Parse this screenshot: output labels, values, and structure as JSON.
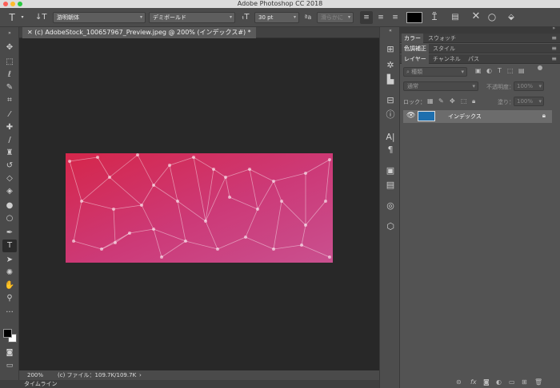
{
  "window": {
    "title": "Adobe Photoshop CC 2018"
  },
  "options": {
    "font_family": "游明朝体",
    "font_style": "デミボールド",
    "font_size": "30 pt",
    "aa_label": "ªa",
    "antialias": "滑らかに",
    "text_color": "#000000"
  },
  "document": {
    "tab_title": "(c) AdobeStock_100657967_Preview.jpeg @ 200% (インデックス#) *",
    "zoom": "200%",
    "file_info": "(c) ファイル：109.7K/109.7K",
    "canvas_colors": [
      "#d5264a",
      "#cc3a78",
      "#c9508f"
    ]
  },
  "timeline": {
    "label": "タイムライン"
  },
  "panels": {
    "tabs_row1": [
      "カラー",
      "スウォッチ"
    ],
    "tabs_row2": [
      "色調補正",
      "スタイル"
    ],
    "tabs_row3": [
      "レイヤー",
      "チャンネル",
      "パス"
    ],
    "filter_placeholder": "種類",
    "blend_mode": "通常",
    "opacity_label": "不透明度：",
    "opacity_value": "100%",
    "lock_label": "ロック：",
    "fill_label": "塗り：",
    "fill_value": "100%",
    "layer_name": "インデックス"
  }
}
